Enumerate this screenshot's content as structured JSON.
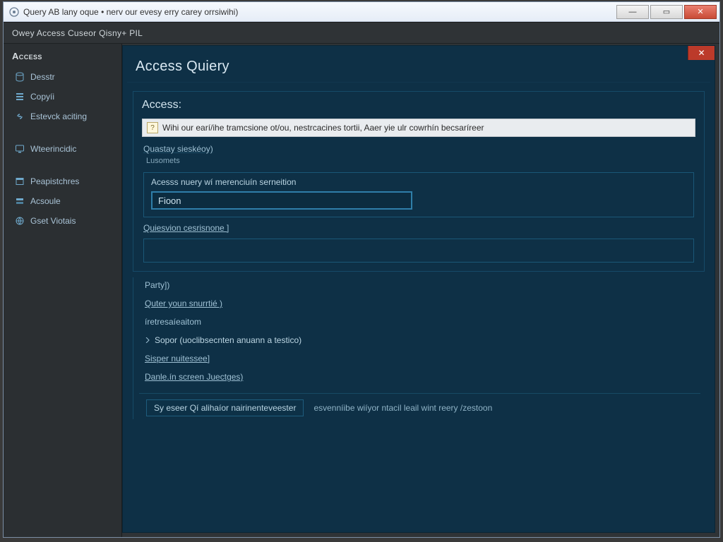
{
  "window": {
    "title": "Query AB  lany oque • nerv our evesy erry carey orrsiwihi)",
    "minimize_glyph": "—",
    "maximize_glyph": "▭",
    "close_glyph": "✕"
  },
  "breadcrumb": "Owey   Access Cuseor Qisny+ PIL",
  "sidebar": {
    "heading": "Access",
    "items": [
      {
        "icon": "database-icon",
        "label": "Desstr"
      },
      {
        "icon": "list-icon",
        "label": "Copyíi"
      },
      {
        "icon": "link-icon",
        "label": "Estevck aciting"
      }
    ],
    "items2": [
      {
        "icon": "monitor-icon",
        "label": "Wteerincidic"
      }
    ],
    "items3": [
      {
        "icon": "window-icon",
        "label": "Peapistchres"
      },
      {
        "icon": "stack-icon",
        "label": "Acsoule"
      },
      {
        "icon": "globe-icon",
        "label": "Gset Viotais"
      }
    ]
  },
  "main": {
    "close_glyph": "✕",
    "title": "Access Quiery",
    "section_title": "Access:",
    "info_text": "Wihi our earí/ihe tramcsione ot/ou, nestrcacines tortii,   Aaer yie ulr cowrhín   becsaríreer",
    "field1_label": "Quastay sieskéoy)",
    "field1_sub": "Lusomets",
    "nested_header": "Acesss nuery wí merenciuín serneition",
    "input_value": "Fioon",
    "link1": "Quiesvion cesrisnone ]",
    "step_party": "Party])",
    "step_query": "Quter youn snurrtié )",
    "step_recv": "íretresaíeaitom",
    "step_sopor": "Sopor (uoclibsecnten anuann a testico)",
    "step_sisper": "Sisper nuitessee]",
    "step_daniel": "Danle.ín screen Juectges)",
    "footer_box": "Sy eseer Qí alihaíor nairinenteveester",
    "footer_text": "esvenníibe wiíyor ntacil leail wint reery /zestoon"
  }
}
